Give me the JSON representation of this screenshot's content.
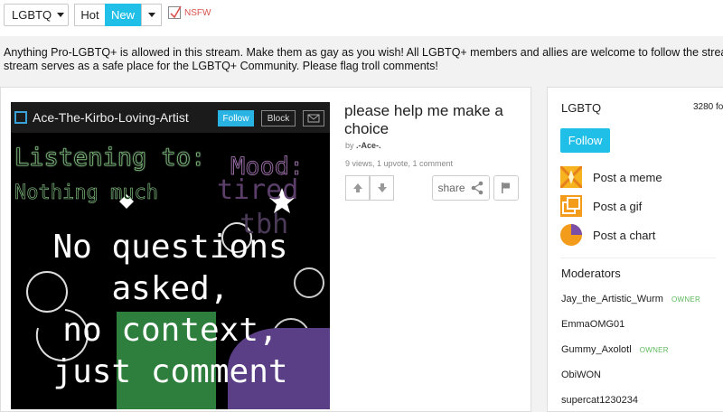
{
  "topbar": {
    "stream_select": "LGBTQ",
    "sort_options": [
      "Hot",
      "New"
    ],
    "active_sort": "New",
    "nsfw_label": "NSFW",
    "nsfw_checked": true
  },
  "description": {
    "line1": "Anything Pro-LGBTQ+ is allowed in this stream. Make them as gay as you wish! All LGBTQ+ members and allies are welcome to follow the stream. Th",
    "line2": "stream serves as a safe place for the LGBTQ+ Community. Please flag troll comments!"
  },
  "post": {
    "image_text": {
      "username": "Ace-The-Kirbo-Loving-Artist",
      "follow": "Follow",
      "block": "Block",
      "listening": "Listening to:",
      "nothing": "Nothing much",
      "mood": "Mood:",
      "tired": "tired",
      "tbh": "tbh",
      "line1": "No questions",
      "line2": "asked,",
      "line3": "no context,",
      "line4": "just comment"
    },
    "title_line1": "please help me make a",
    "title_line2": "choice",
    "author_prefix": "by",
    "author": ".-Ace-.",
    "stats": "9 views, 1 upvote, 1 comment",
    "share_label": "share"
  },
  "sidebar": {
    "stream_name": "LGBTQ",
    "followers": "3280 fo",
    "follow_label": "Follow",
    "actions": [
      {
        "label": "Post a meme",
        "icon": "meme-icon"
      },
      {
        "label": "Post a gif",
        "icon": "gif-icon"
      },
      {
        "label": "Post a chart",
        "icon": "chart-icon"
      }
    ],
    "moderators_title": "Moderators",
    "moderators": [
      {
        "name": "Jay_the_Artistic_Wurm",
        "badge": "OWNER"
      },
      {
        "name": "EmmaOMG01",
        "badge": ""
      },
      {
        "name": "Gummy_Axolotl",
        "badge": "OWNER"
      },
      {
        "name": "ObiWON",
        "badge": ""
      },
      {
        "name": "supercat1230234",
        "badge": ""
      }
    ]
  },
  "colors": {
    "accent": "#20bfe8",
    "owner_badge": "#5cb85c",
    "nsfw": "#d9534f"
  }
}
